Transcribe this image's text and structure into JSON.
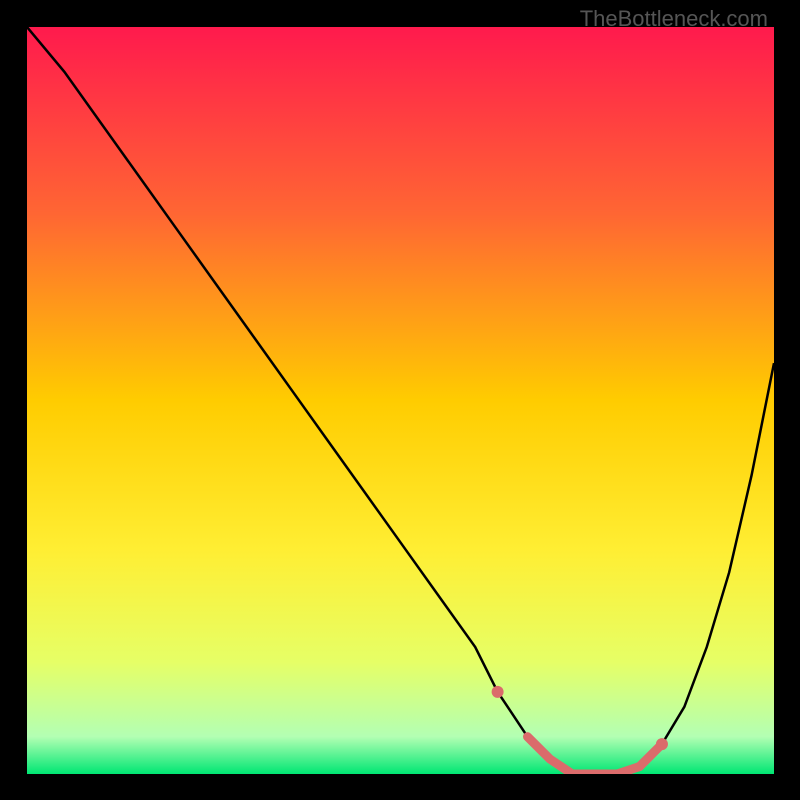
{
  "watermark": "TheBottleneck.com",
  "chart_data": {
    "type": "line",
    "title": "",
    "xlabel": "",
    "ylabel": "",
    "xlim": [
      0,
      100
    ],
    "ylim": [
      0,
      100
    ],
    "series": [
      {
        "name": "curve",
        "color": "#000000",
        "x": [
          0,
          5,
          10,
          15,
          20,
          25,
          30,
          35,
          40,
          45,
          50,
          55,
          60,
          63,
          67,
          70,
          73,
          76,
          79,
          82,
          85,
          88,
          91,
          94,
          97,
          100
        ],
        "y": [
          100,
          94,
          87,
          80,
          73,
          66,
          59,
          52,
          45,
          38,
          31,
          24,
          17,
          11,
          5,
          2,
          0,
          0,
          0,
          1,
          4,
          9,
          17,
          27,
          40,
          55
        ]
      },
      {
        "name": "highlight",
        "color": "#db6b6b",
        "x": [
          63,
          67,
          70,
          73,
          76,
          79,
          82,
          85
        ],
        "y": [
          11,
          5,
          2,
          0,
          0,
          0,
          1,
          4
        ]
      }
    ],
    "gradient_stops": [
      {
        "offset": 0,
        "color": "#ff1a4d"
      },
      {
        "offset": 25,
        "color": "#ff6633"
      },
      {
        "offset": 50,
        "color": "#ffcc00"
      },
      {
        "offset": 70,
        "color": "#ffee33"
      },
      {
        "offset": 85,
        "color": "#e6ff66"
      },
      {
        "offset": 95,
        "color": "#b3ffb3"
      },
      {
        "offset": 100,
        "color": "#00e673"
      }
    ]
  }
}
